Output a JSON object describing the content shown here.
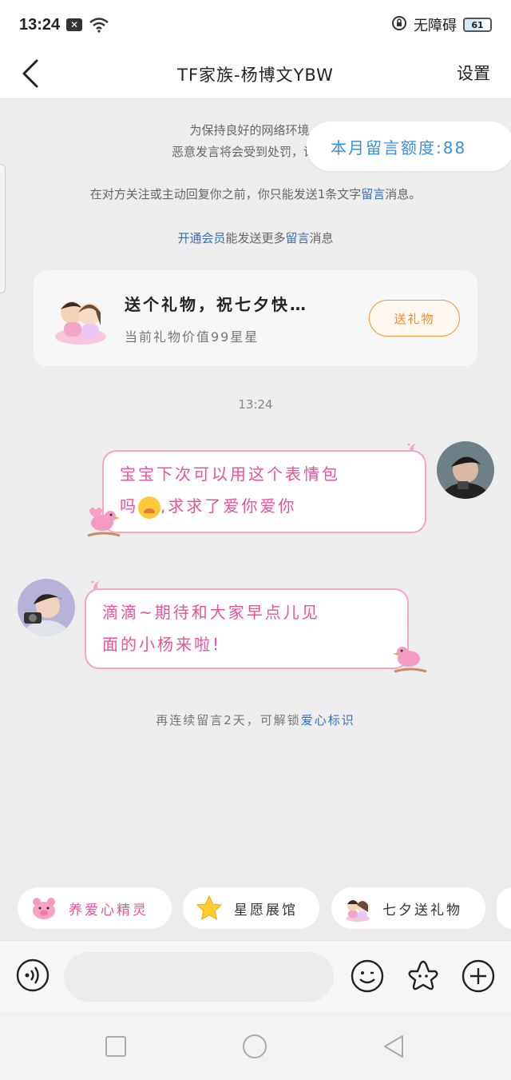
{
  "status_bar": {
    "time": "13:24",
    "accessibility_label": "无障碍",
    "battery": "61"
  },
  "header": {
    "title": "TF家族-杨博文YBW",
    "settings_label": "设置"
  },
  "notices": {
    "line1": "为保持良好的网络环境，",
    "line2": "恶意发言将会受到处罚，详细细",
    "quota_label": "本月留言额度:88",
    "limit_line_a": "在对方关注或主动回复你之前，你只能发送1条文字",
    "limit_highlight": "留言",
    "limit_line_b": "消息。",
    "vip_highlight_1": "开通会员",
    "vip_text": "能发送更多",
    "vip_highlight_2": "留言",
    "vip_tail": "消息"
  },
  "gift_card": {
    "title": "送个礼物，祝七夕快…",
    "subtitle": "当前礼物价值99星星",
    "button_label": "送礼物"
  },
  "chat": {
    "timestamp": "13:24",
    "messages": [
      {
        "side": "right",
        "line1": "宝宝下次可以用这个表情包",
        "line2_pre": "吗",
        "line2_post": ",求求了爱你爱你"
      },
      {
        "side": "left",
        "line1": "滴滴~期待和大家早点儿见",
        "line2": "面的小杨来啦!"
      }
    ]
  },
  "unlock_hint": {
    "text": "再连续留言2天，可解锁",
    "highlight": "爱心标识"
  },
  "shortcuts": [
    {
      "label": "养爱心精灵"
    },
    {
      "label": "星愿展馆"
    },
    {
      "label": "七夕送礼物"
    }
  ],
  "input": {
    "placeholder": ""
  },
  "colors": {
    "accent_blue": "#3a6fb5",
    "bubble_pink": "#f0509a",
    "gift_orange": "#f08a2a"
  }
}
